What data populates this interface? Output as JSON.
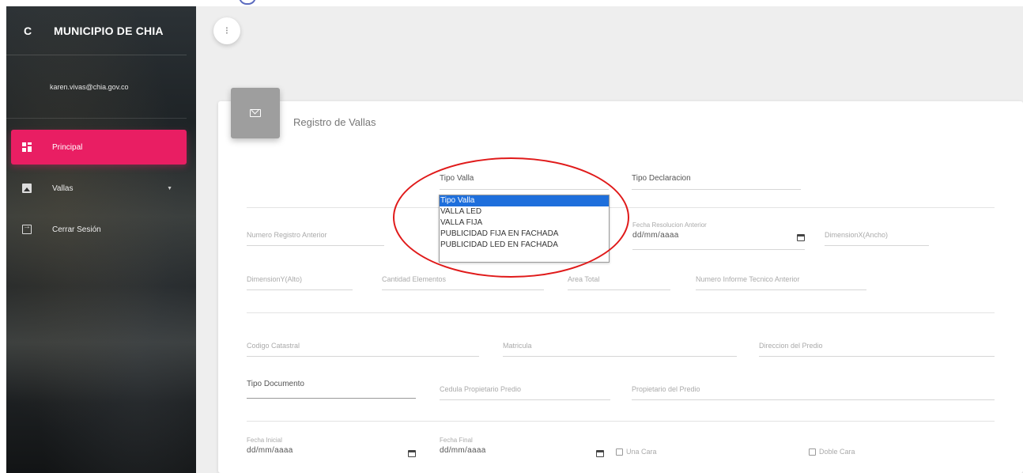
{
  "sidebar": {
    "brand_mini": "C",
    "brand_name": "MUNICIPIO DE CHIA",
    "user_email": "karen.vivas@chia.gov.co",
    "items": [
      {
        "label": "Principal"
      },
      {
        "label": "Vallas"
      },
      {
        "label": "Cerrar Sesión"
      }
    ]
  },
  "colors": {
    "accent": "#e91e63",
    "selection": "#1e6fdc",
    "annotation": "#e01a1a"
  },
  "card": {
    "title": "Registro de Vallas"
  },
  "form": {
    "tipo_valla": "Tipo Valla",
    "tipo_declaracion": "Tipo Declaracion",
    "tipo_valla_options": [
      "Tipo Valla",
      "VALLA LED",
      "VALLA FIJA",
      "PUBLICIDAD FIJA EN FACHADA",
      "PUBLICIDAD LED EN FACHADA"
    ],
    "numero_registro_anterior": "Numero Registro Anterior",
    "fecha_resolucion_anterior": "Fecha Resolucion Anterior",
    "date_placeholder": "dd/mm/aaaa",
    "dimension_x": "DimensionX(Ancho)",
    "dimension_y": "DimensionY(Alto)",
    "cantidad_elementos": "Cantidad Elementos",
    "area_total": "Area Total",
    "numero_informe": "Numero Informe Tecnico Anterior",
    "codigo_catastral": "Codigo Catastral",
    "matricula": "Matricula",
    "direccion_predio": "Direccion del Predio",
    "tipo_documento": "Tipo Documento",
    "cedula_propietario": "Cedula Propietario Predio",
    "propietario_predio": "Propietario del Predio",
    "fecha_inicial": "Fecha Inicial",
    "fecha_final": "Fecha Final",
    "una_cara": "Una Cara",
    "doble_cara": "Doble Cara"
  }
}
